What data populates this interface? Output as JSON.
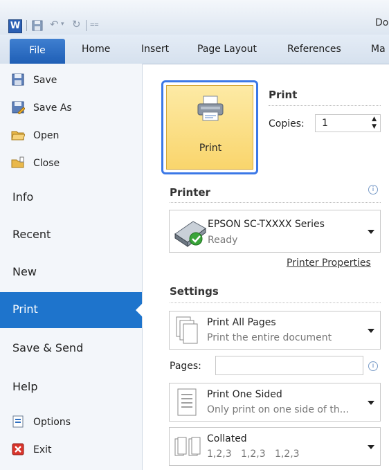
{
  "titlebar": {
    "app_letter": "W",
    "title_fragment": "Do"
  },
  "tabs": {
    "file": "File",
    "home": "Home",
    "insert": "Insert",
    "page_layout": "Page Layout",
    "references": "References",
    "mailings_fragment": "Ma"
  },
  "nav": {
    "save": "Save",
    "save_as": "Save As",
    "open": "Open",
    "close": "Close",
    "info": "Info",
    "recent": "Recent",
    "new": "New",
    "print": "Print",
    "save_send": "Save & Send",
    "help": "Help",
    "options": "Options",
    "exit": "Exit"
  },
  "print": {
    "heading": "Print",
    "button_label": "Print",
    "copies_label": "Copies:",
    "copies_value": "1"
  },
  "printer": {
    "heading": "Printer",
    "name": "EPSON SC-TXXXX Series",
    "status": "Ready",
    "properties_link": "Printer Properties"
  },
  "settings": {
    "heading": "Settings",
    "pages_option": {
      "title": "Print All Pages",
      "desc": "Print the entire document"
    },
    "pages_label": "Pages:",
    "sided_option": {
      "title": "Print One Sided",
      "desc": "Only print on one side of th..."
    },
    "collate_option": {
      "title": "Collated",
      "desc": "1,2,3   1,2,3   1,2,3"
    }
  },
  "colors": {
    "accent": "#1e74cc",
    "print_button": "#fbe08a",
    "focus_ring": "#3b78e7",
    "ready_badge": "#3aa43a",
    "exit_red": "#d9342b"
  }
}
